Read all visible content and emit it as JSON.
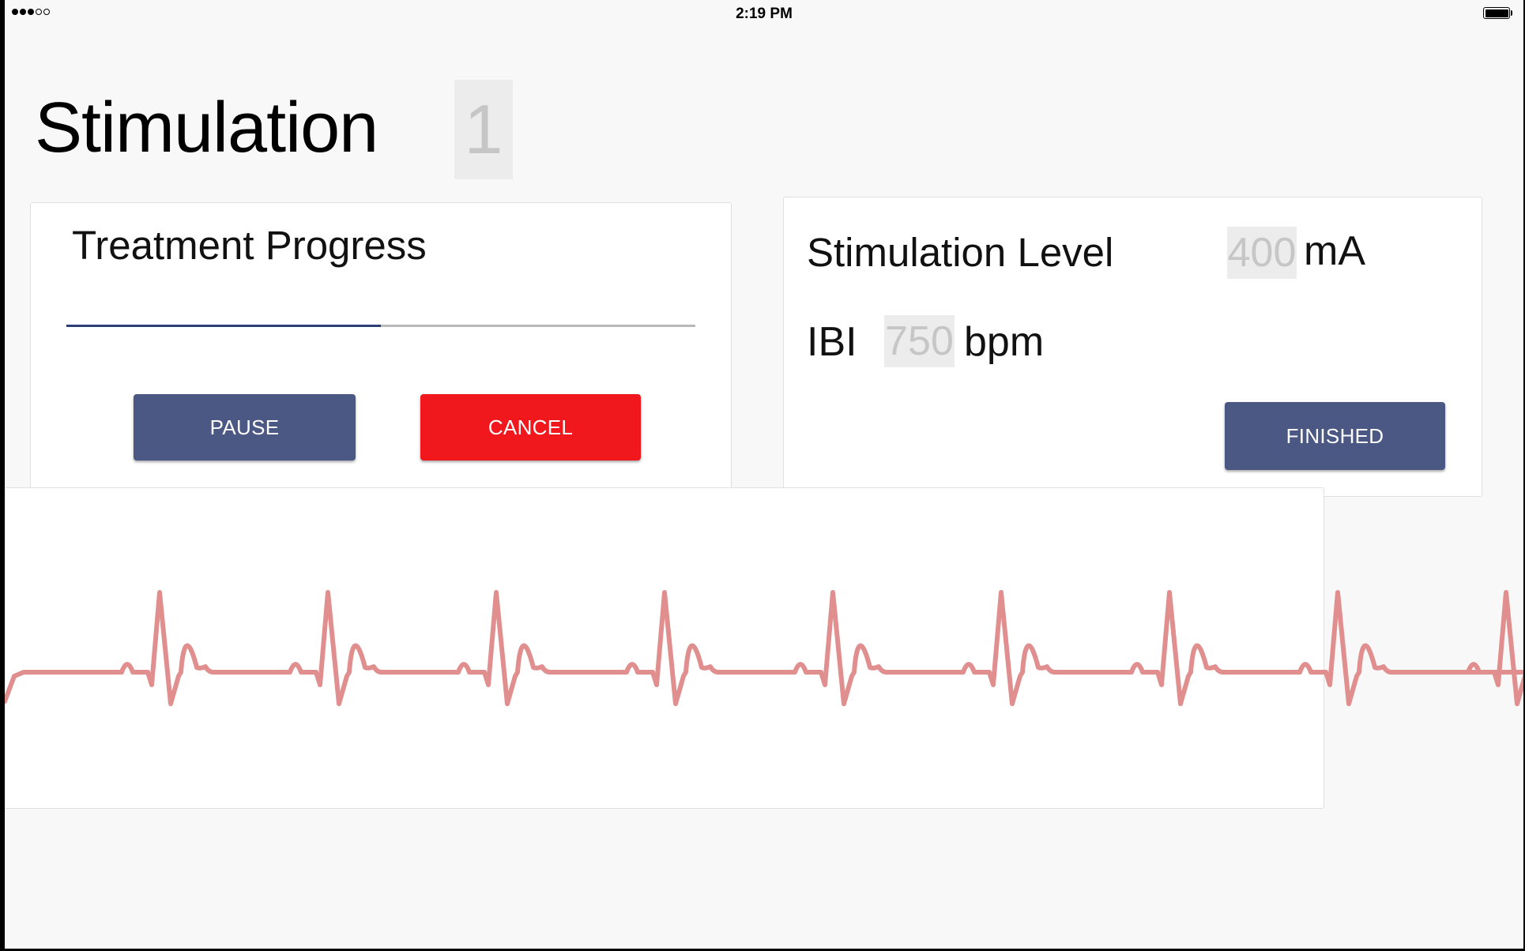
{
  "status_bar": {
    "time": "2:19 PM",
    "signal_bars_filled": 3,
    "signal_bars_total": 5
  },
  "header": {
    "title": "Stimulation",
    "session_number": "1"
  },
  "progress_card": {
    "title": "Treatment Progress",
    "progress_fraction": 0.5,
    "pause_label": "PAUSE",
    "cancel_label": "CANCEL"
  },
  "level_card": {
    "level_label": "Stimulation Level",
    "level_value": "400",
    "level_unit": "mA",
    "ibi_label": "IBI",
    "ibi_value": "750",
    "ibi_unit": "bpm",
    "finished_label": "FINISHED"
  },
  "ecg": {
    "beats": 9,
    "color": "#e08e8e"
  },
  "colors": {
    "primary": "#4b5884",
    "danger": "#f0171d",
    "progress": "#2c3e78"
  }
}
